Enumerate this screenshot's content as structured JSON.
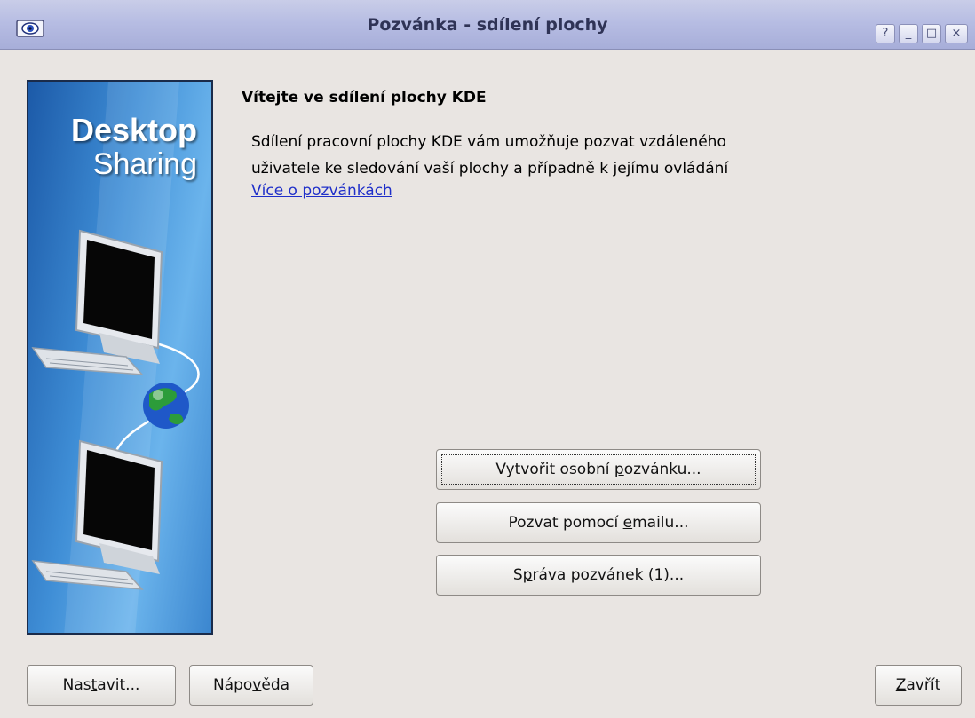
{
  "window": {
    "title": "Pozvánka - sdílení plochy",
    "controls": [
      "?",
      "_",
      "□",
      "×"
    ]
  },
  "banner": {
    "title_line1": "Desktop",
    "title_line2": "Sharing"
  },
  "main": {
    "heading": "Vítejte ve sdílení plochy KDE",
    "description_line1": "Sdílení pracovní plochy KDE vám umožňuje pozvat vzdáleného",
    "description_line2": "uživatele ke sledování vaší plochy a případně k jejímu ovládání",
    "link": "Více o pozvánkách"
  },
  "actions": {
    "create_personal": {
      "before": "Vytvořit osobní ",
      "mnemonic": "p",
      "after": "ozvánku..."
    },
    "invite_email": {
      "before": "Pozvat pomocí ",
      "mnemonic": "e",
      "after": "mailu..."
    },
    "manage": {
      "before": "S",
      "mnemonic": "p",
      "after": "ráva pozvánek (1)..."
    }
  },
  "footer": {
    "configure": {
      "before": "Nas",
      "mnemonic": "t",
      "after": "avit..."
    },
    "help": {
      "before": "Nápo",
      "mnemonic": "v",
      "after": "ěda"
    },
    "close": {
      "before": "",
      "mnemonic": "Z",
      "after": "avřít"
    }
  },
  "colors": {
    "titlebar": "#b7bde3",
    "window_bg": "#e9e5e2",
    "link": "#1f2fc9",
    "banner_blue": "#3f8ed6"
  }
}
